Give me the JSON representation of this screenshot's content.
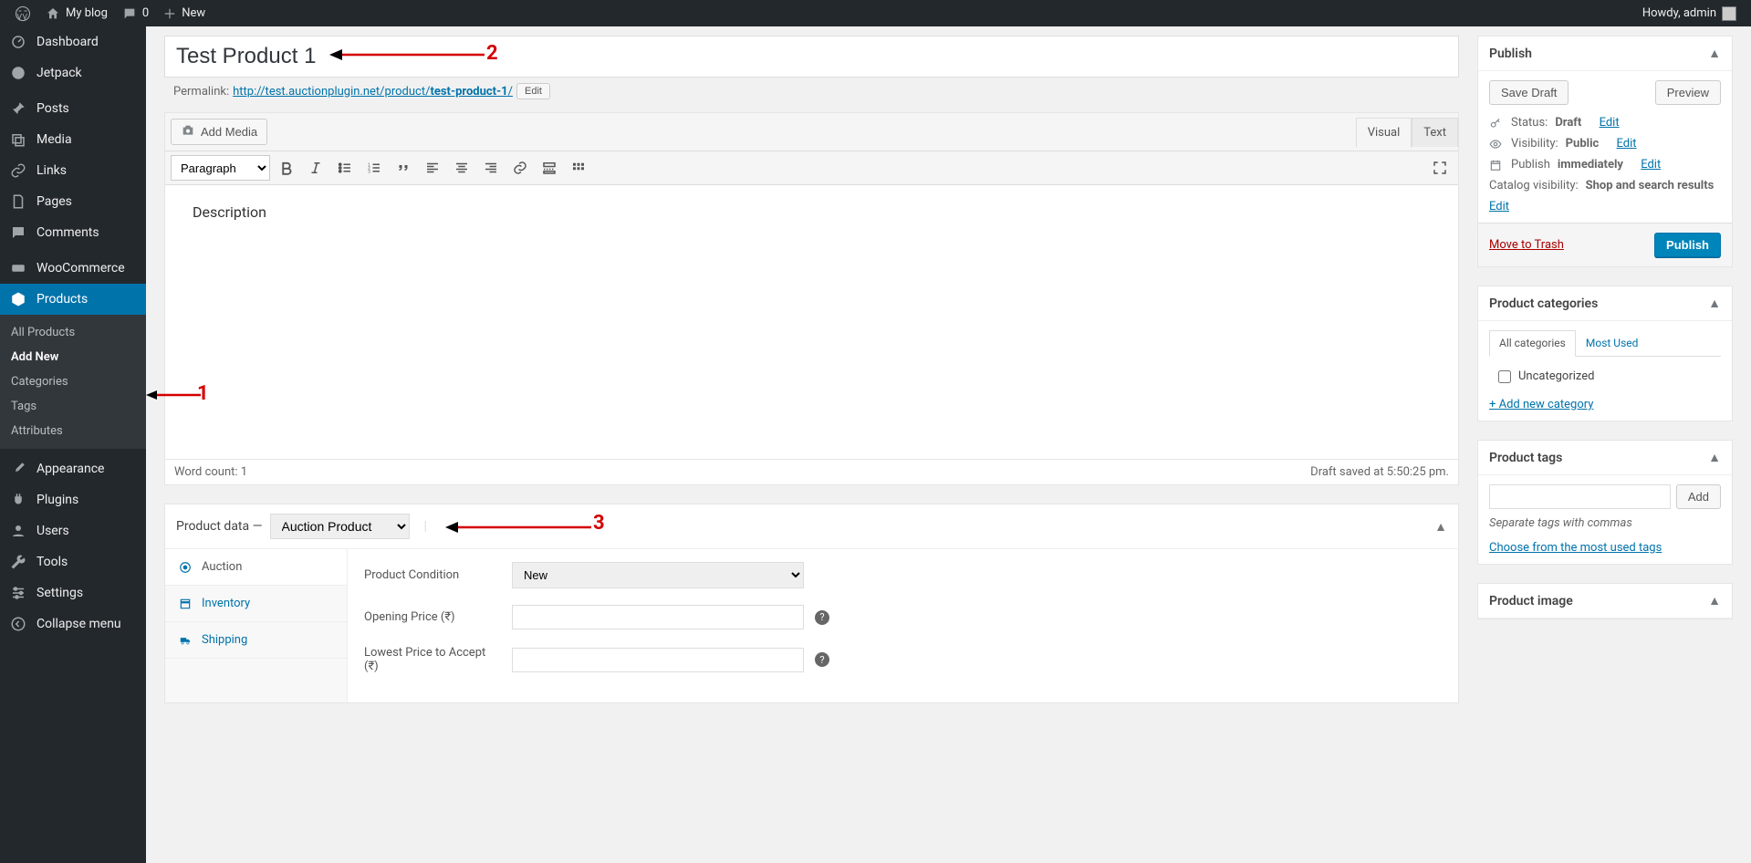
{
  "adminbar": {
    "site_name": "My blog",
    "comment_count": "0",
    "new_label": "New",
    "howdy": "Howdy, admin"
  },
  "sidebar": {
    "items": [
      {
        "label": "Dashboard"
      },
      {
        "label": "Jetpack"
      },
      {
        "label": "Posts"
      },
      {
        "label": "Media"
      },
      {
        "label": "Links"
      },
      {
        "label": "Pages"
      },
      {
        "label": "Comments"
      },
      {
        "label": "WooCommerce"
      },
      {
        "label": "Products"
      }
    ],
    "products_submenu": [
      {
        "label": "All Products"
      },
      {
        "label": "Add New"
      },
      {
        "label": "Categories"
      },
      {
        "label": "Tags"
      },
      {
        "label": "Attributes"
      }
    ],
    "items2": [
      {
        "label": "Appearance"
      },
      {
        "label": "Plugins"
      },
      {
        "label": "Users"
      },
      {
        "label": "Tools"
      },
      {
        "label": "Settings"
      },
      {
        "label": "Collapse menu"
      }
    ]
  },
  "title": "Test Product 1",
  "permalink": {
    "label": "Permalink:",
    "base": "http://test.auctionplugin.net/product/",
    "slug": "test-product-1",
    "slash": "/",
    "edit_btn": "Edit"
  },
  "editor": {
    "add_media": "Add Media",
    "tab_visual": "Visual",
    "tab_text": "Text",
    "format_select": "Paragraph",
    "content": "Description",
    "word_count_label": "Word count: ",
    "word_count": "1",
    "draft_saved": "Draft saved at 5:50:25 pm."
  },
  "product_data": {
    "heading": "Product data —",
    "type_select": "Auction Product",
    "tabs": [
      {
        "label": "Auction"
      },
      {
        "label": "Inventory"
      },
      {
        "label": "Shipping"
      }
    ],
    "fields": {
      "condition_label": "Product Condition",
      "condition_value": "New",
      "opening_label": "Opening Price (₹)",
      "lowest_label": "Lowest Price to Accept (₹)"
    }
  },
  "publish": {
    "heading": "Publish",
    "save_draft": "Save Draft",
    "preview": "Preview",
    "status_label": "Status: ",
    "status_value": "Draft",
    "visibility_label": "Visibility: ",
    "visibility_value": "Public",
    "publish_label": "Publish ",
    "publish_value": "immediately",
    "catalog_label": "Catalog visibility: ",
    "catalog_value": "Shop and search results",
    "edit_link": "Edit",
    "trash": "Move to Trash",
    "publish_btn": "Publish"
  },
  "categories_box": {
    "heading": "Product categories",
    "tab_all": "All categories",
    "tab_most": "Most Used",
    "uncategorized": "Uncategorized",
    "add_new": "+ Add new category"
  },
  "tags_box": {
    "heading": "Product tags",
    "add_btn": "Add",
    "hint": "Separate tags with commas",
    "choose": "Choose from the most used tags"
  },
  "image_box": {
    "heading": "Product image"
  },
  "annotations": {
    "n1": "1",
    "n2": "2",
    "n3": "3"
  }
}
